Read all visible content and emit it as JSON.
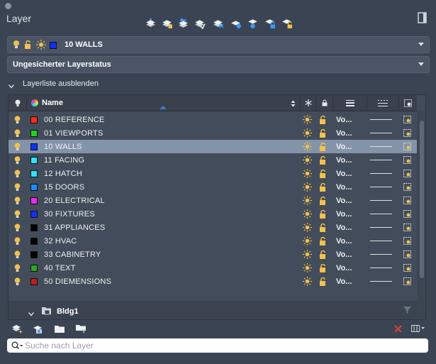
{
  "panel": {
    "title": "Layer"
  },
  "current_layer": {
    "name": "10 WALLS",
    "color": "#1030ff"
  },
  "layer_state": {
    "value": "Ungesicherter Layerstatus"
  },
  "collapse": {
    "label": "Layerliste ausblenden"
  },
  "columns": {
    "name": "Name",
    "linetype_short": "Vo..."
  },
  "layers": [
    {
      "name": "00 REFERENCE",
      "color": "#ff2a1a",
      "linetype": "Vo...",
      "selected": false
    },
    {
      "name": "01 VIEWPORTS",
      "color": "#22d322",
      "linetype": "Vo...",
      "selected": false
    },
    {
      "name": "10 WALLS",
      "color": "#1030ff",
      "linetype": "Vo...",
      "selected": true
    },
    {
      "name": "11 FACING",
      "color": "#28e6ff",
      "linetype": "Vo...",
      "selected": false
    },
    {
      "name": "12 HATCH",
      "color": "#28e6ff",
      "linetype": "Vo...",
      "selected": false
    },
    {
      "name": "15 DOORS",
      "color": "#1a8fff",
      "linetype": "Vo...",
      "selected": false
    },
    {
      "name": "20 ELECTRICAL",
      "color": "#e62ef0",
      "linetype": "Vo...",
      "selected": false
    },
    {
      "name": "30 FIXTURES",
      "color": "#1030ff",
      "linetype": "Vo...",
      "selected": false
    },
    {
      "name": "31 APPLIANCES",
      "color": "#000000",
      "linetype": "Vo...",
      "selected": false
    },
    {
      "name": "32 HVAC",
      "color": "#000000",
      "linetype": "Vo...",
      "selected": false
    },
    {
      "name": "33 CABINETRY",
      "color": "#000000",
      "linetype": "Vo...",
      "selected": false
    },
    {
      "name": "40 TEXT",
      "color": "#2aa81e",
      "linetype": "Vo...",
      "selected": false
    },
    {
      "name": "50 DIEMENSIONS",
      "color": "#b81e1e",
      "linetype": "Vo...",
      "selected": false
    }
  ],
  "group": {
    "name": "Bldg1"
  },
  "search": {
    "placeholder": "Suche nach Layer"
  },
  "colors": {
    "bulb": "#f2c14e",
    "sun": "#f2c14e",
    "lock": "#f2c14e",
    "accent_cursor": "#3a7bd5",
    "close_red": "#d9423b"
  }
}
